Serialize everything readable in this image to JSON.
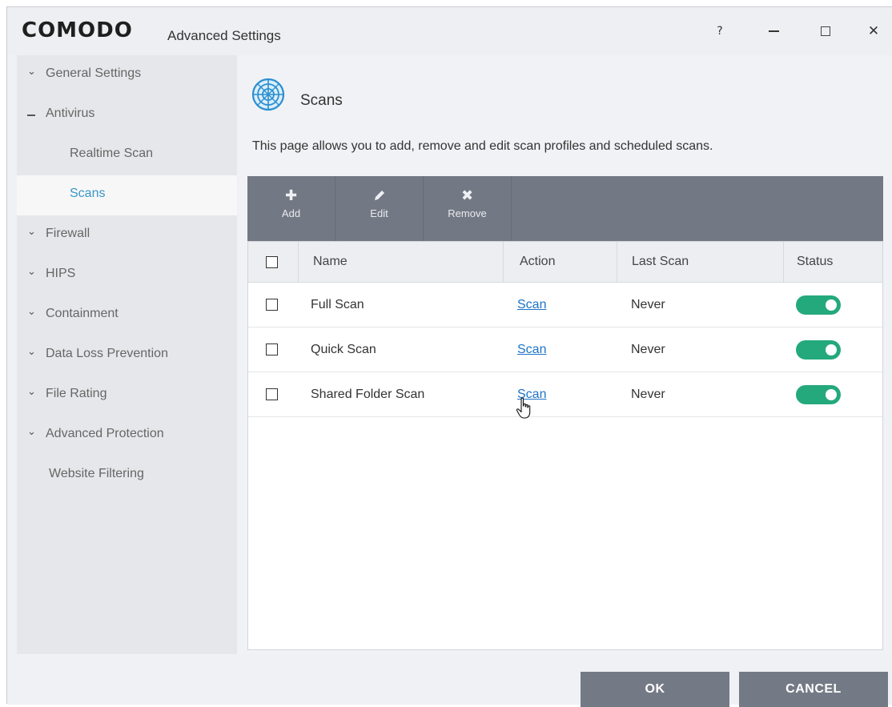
{
  "window": {
    "logo": "COMODO",
    "title": "Advanced Settings",
    "controls": {
      "help": "?",
      "close": "✕"
    }
  },
  "sidebar": {
    "items": [
      {
        "label": "General Settings",
        "state": "collapsed"
      },
      {
        "label": "Antivirus",
        "state": "expanded"
      },
      {
        "label": "Realtime Scan",
        "state": "child"
      },
      {
        "label": "Scans",
        "state": "child-active"
      },
      {
        "label": "Firewall",
        "state": "collapsed"
      },
      {
        "label": "HIPS",
        "state": "collapsed"
      },
      {
        "label": "Containment",
        "state": "collapsed"
      },
      {
        "label": "Data Loss Prevention",
        "state": "collapsed"
      },
      {
        "label": "File Rating",
        "state": "collapsed"
      },
      {
        "label": "Advanced Protection",
        "state": "collapsed"
      },
      {
        "label": "Website Filtering",
        "state": "leaf"
      }
    ]
  },
  "main": {
    "title": "Scans",
    "description": "This page allows you to add, remove and edit scan profiles and scheduled scans.",
    "toolbar": {
      "add": "Add",
      "edit": "Edit",
      "remove": "Remove"
    },
    "table": {
      "columns": [
        "Name",
        "Action",
        "Last Scan",
        "Status"
      ],
      "rows": [
        {
          "name": "Full Scan",
          "action": "Scan",
          "last_scan": "Never",
          "status_on": true
        },
        {
          "name": "Quick Scan",
          "action": "Scan",
          "last_scan": "Never",
          "status_on": true
        },
        {
          "name": "Shared Folder Scan",
          "action": "Scan",
          "last_scan": "Never",
          "status_on": true
        }
      ]
    }
  },
  "footer": {
    "ok": "OK",
    "cancel": "CANCEL"
  },
  "colors": {
    "toolbar_bg": "#737984",
    "toggle_on": "#24a97c",
    "link": "#1e73c6",
    "active_nav": "#3a96c8"
  }
}
